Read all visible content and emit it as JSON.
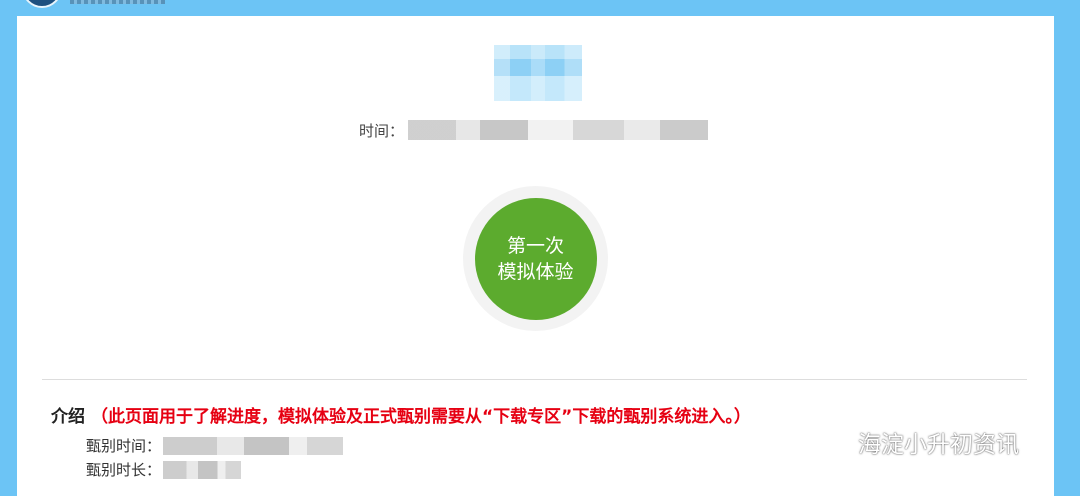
{
  "header": {
    "logo_icon": "site-logo-icon"
  },
  "exam": {
    "time_label": "时间：",
    "start_button": {
      "line1": "第一次",
      "line2": "模拟体验"
    }
  },
  "intro": {
    "label": "介绍",
    "note": "（此页面用于了解进度，模拟体验及正式甄别需要从“下载专区”下载的甄别系统进入。）",
    "fields": [
      {
        "label": "甄别时间："
      },
      {
        "label": "甄别时长："
      }
    ]
  },
  "watermark": {
    "icon": "wechat-icon",
    "text": "海淀小升初资讯"
  },
  "colors": {
    "page_bg": "#6cc4f5",
    "card_bg": "#ffffff",
    "button_green": "#5cab2e",
    "note_red": "#e60012"
  }
}
